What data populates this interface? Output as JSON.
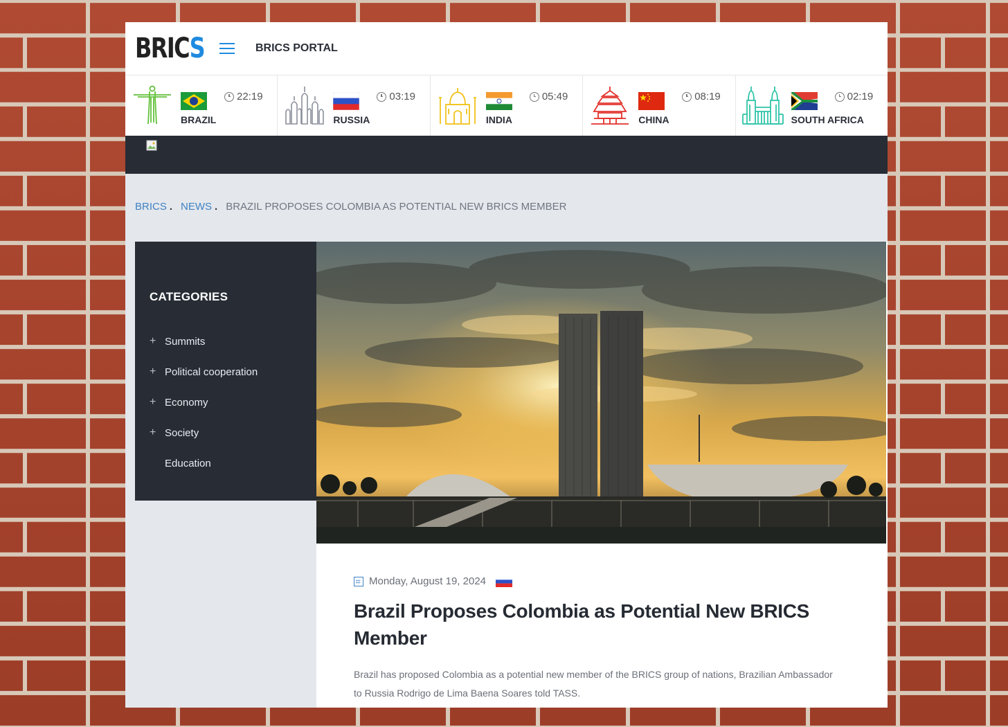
{
  "header": {
    "logo_main": "BRIC",
    "logo_accent": "S",
    "menu_icon": "hamburger-icon",
    "portal_title": "BRICS PORTAL"
  },
  "countries": [
    {
      "name": "BRAZIL",
      "time": "22:19",
      "monument": "christ-redeemer-icon",
      "flag": "brazil-flag"
    },
    {
      "name": "RUSSIA",
      "time": "03:19",
      "monument": "st-basils-icon",
      "flag": "russia-flag"
    },
    {
      "name": "INDIA",
      "time": "05:49",
      "monument": "taj-mahal-icon",
      "flag": "india-flag"
    },
    {
      "name": "CHINA",
      "time": "08:19",
      "monument": "temple-of-heaven-icon",
      "flag": "china-flag"
    },
    {
      "name": "SOUTH AFRICA",
      "time": "02:19",
      "monument": "union-buildings-icon",
      "flag": "south-africa-flag"
    }
  ],
  "breadcrumb": {
    "items": [
      "BRICS",
      "NEWS"
    ],
    "current": "BRAZIL PROPOSES COLOMBIA AS POTENTIAL NEW BRICS MEMBER"
  },
  "sidebar": {
    "title": "CATEGORIES",
    "items": [
      {
        "label": "Summits",
        "expandable": true
      },
      {
        "label": "Political cooperation",
        "expandable": true
      },
      {
        "label": "Economy",
        "expandable": true
      },
      {
        "label": "Society",
        "expandable": true
      },
      {
        "label": "Education",
        "expandable": false
      }
    ]
  },
  "article": {
    "date": "Monday, August 19, 2024",
    "source_flag": "russia-flag",
    "title": "Brazil Proposes Colombia as Potential New BRICS Member",
    "lead": "Brazil has proposed Colombia as a potential new member of the BRICS group of nations, Brazilian Ambassador to Russia Rodrigo de Lima Baena Soares told TASS."
  },
  "colors": {
    "accent": "#1f8be0",
    "dark": "#272c35",
    "link": "#3f82c4",
    "brick": "#a8452e"
  }
}
